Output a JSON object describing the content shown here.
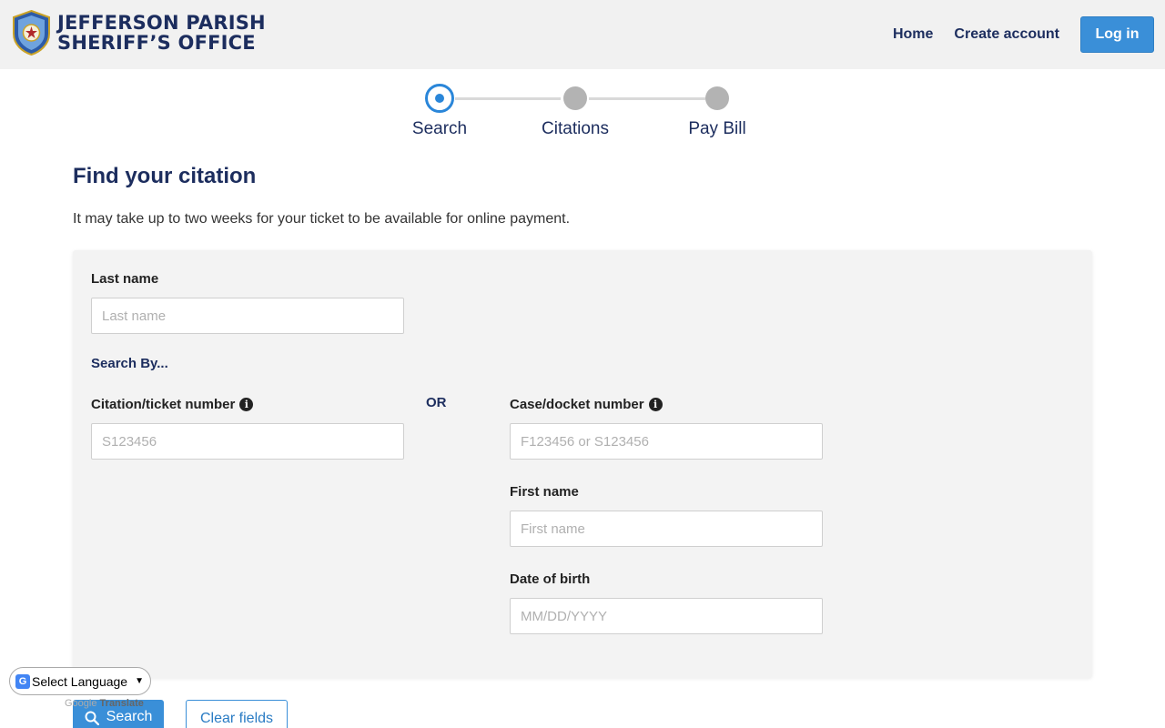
{
  "header": {
    "brand_line1": "JEFFERSON PARISH",
    "brand_line2": "SHERIFF’S OFFICE",
    "nav": {
      "home": "Home",
      "create_account": "Create account",
      "login": "Log in"
    }
  },
  "stepper": {
    "steps": [
      {
        "label": "Search",
        "state": "active"
      },
      {
        "label": "Citations",
        "state": "inactive"
      },
      {
        "label": "Pay Bill",
        "state": "inactive"
      }
    ]
  },
  "main": {
    "title": "Find your citation",
    "subtitle": "It may take up to two weeks for your ticket to be available for online payment."
  },
  "form": {
    "last_name": {
      "label": "Last name",
      "placeholder": "Last name",
      "value": ""
    },
    "search_by": "Search By...",
    "or": "OR",
    "citation_number": {
      "label": "Citation/ticket number",
      "placeholder": "S123456",
      "value": ""
    },
    "case_number": {
      "label": "Case/docket number",
      "placeholder": "F123456 or S123456",
      "value": ""
    },
    "first_name": {
      "label": "First name",
      "placeholder": "First name",
      "value": ""
    },
    "dob": {
      "label": "Date of birth",
      "placeholder": "MM/DD/YYYY",
      "value": ""
    },
    "info_icon_glyph": "i"
  },
  "actions": {
    "search": "Search",
    "clear": "Clear fields"
  },
  "translate": {
    "select_label": "Select Language",
    "powered_prefix": "Google",
    "powered_suffix": "Translate",
    "g_glyph": "G"
  },
  "colors": {
    "brand_navy": "#1c2d5e",
    "accent_blue": "#3a8fd8",
    "panel_bg": "#f3f3f3",
    "header_bg": "#f1f1f1"
  },
  "icons": [
    "sheriff-badge-icon",
    "info-icon",
    "search-icon",
    "google-g-icon",
    "chevron-down-icon"
  ]
}
